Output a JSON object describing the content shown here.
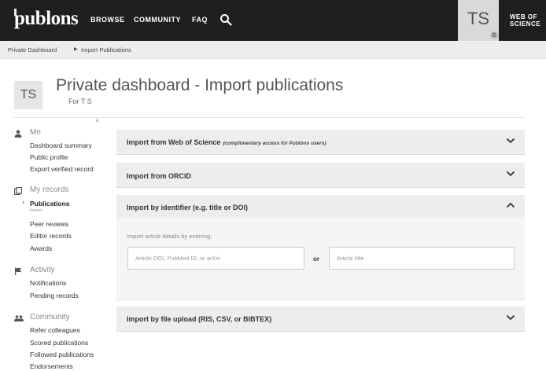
{
  "topbar": {
    "logo": "publons",
    "nav": [
      "BROWSE",
      "COMMUNITY",
      "FAQ"
    ],
    "avatar_initials": "TS",
    "wos_line1": "WEB OF",
    "wos_line2": "SCIENCE"
  },
  "breadcrumb": [
    "Private Dashboard",
    "Import Publications"
  ],
  "page": {
    "avatar_initials": "TS",
    "title": "Private dashboard - Import publications",
    "subtitle": "For T S"
  },
  "sidebar": {
    "collapse": "‹",
    "sections": [
      {
        "icon": "person-icon",
        "title": "Me",
        "items": [
          "Dashboard summary",
          "Public profile",
          "Export verified record"
        ]
      },
      {
        "icon": "records-icon",
        "title": "My records",
        "items": [
          "Publications",
          "Peer reviews",
          "Editor records",
          "Awards"
        ],
        "active_item": "Publications",
        "active_sub": "Import"
      },
      {
        "icon": "flag-icon",
        "title": "Activity",
        "items": [
          "Notifications",
          "Pending records"
        ]
      },
      {
        "icon": "community-icon",
        "title": "Community",
        "items": [
          "Refer colleagues",
          "Scored publications",
          "Followed publications",
          "Endorsements"
        ]
      }
    ]
  },
  "panels": [
    {
      "title": "Import from Web of Science",
      "note": "(complimentary access for Publons users)",
      "state": "collapsed"
    },
    {
      "title": "Import from ORCID",
      "note": "",
      "state": "collapsed"
    },
    {
      "title": "Import by identifier (e.g. title or DOI)",
      "note": "",
      "state": "expanded"
    },
    {
      "title": "Import by file upload (RIS, CSV, or BIBTEX)",
      "note": "",
      "state": "collapsed"
    }
  ],
  "identifier_form": {
    "hint": "Import article details by entering:",
    "doi_placeholder": "Article DOI, PubMed ID, or arXiv",
    "doi_value": "",
    "or_label": "or",
    "title_placeholder": "Article title",
    "title_value": ""
  },
  "colors": {
    "topbar": "#1f1f1f",
    "accent": "#e05a2b",
    "panel": "#ededed"
  }
}
